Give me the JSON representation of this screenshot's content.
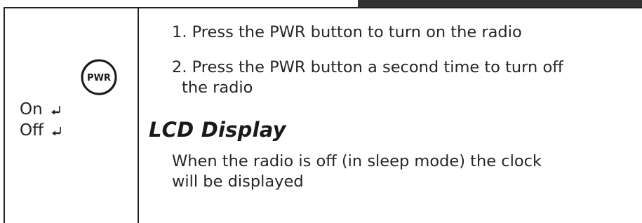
{
  "sidebar": {
    "pwr_icon_label": "PWR",
    "on_label": "On",
    "off_label": "Off"
  },
  "steps": [
    {
      "text": "1. Press the PWR button to turn on the radio"
    },
    {
      "line1": "2. Press the PWR button a second time to turn off",
      "line2": "the radio"
    }
  ],
  "section": {
    "heading": "LCD Display",
    "body_line1": "When the radio is off (in sleep mode) the clock",
    "body_line2": "will be displayed"
  },
  "colors": {
    "text": "#222222",
    "rule": "#222222",
    "bar": "#333333"
  },
  "icons": {
    "power_button": "pwr-button-icon",
    "enter_key": "enter-key-icon"
  }
}
